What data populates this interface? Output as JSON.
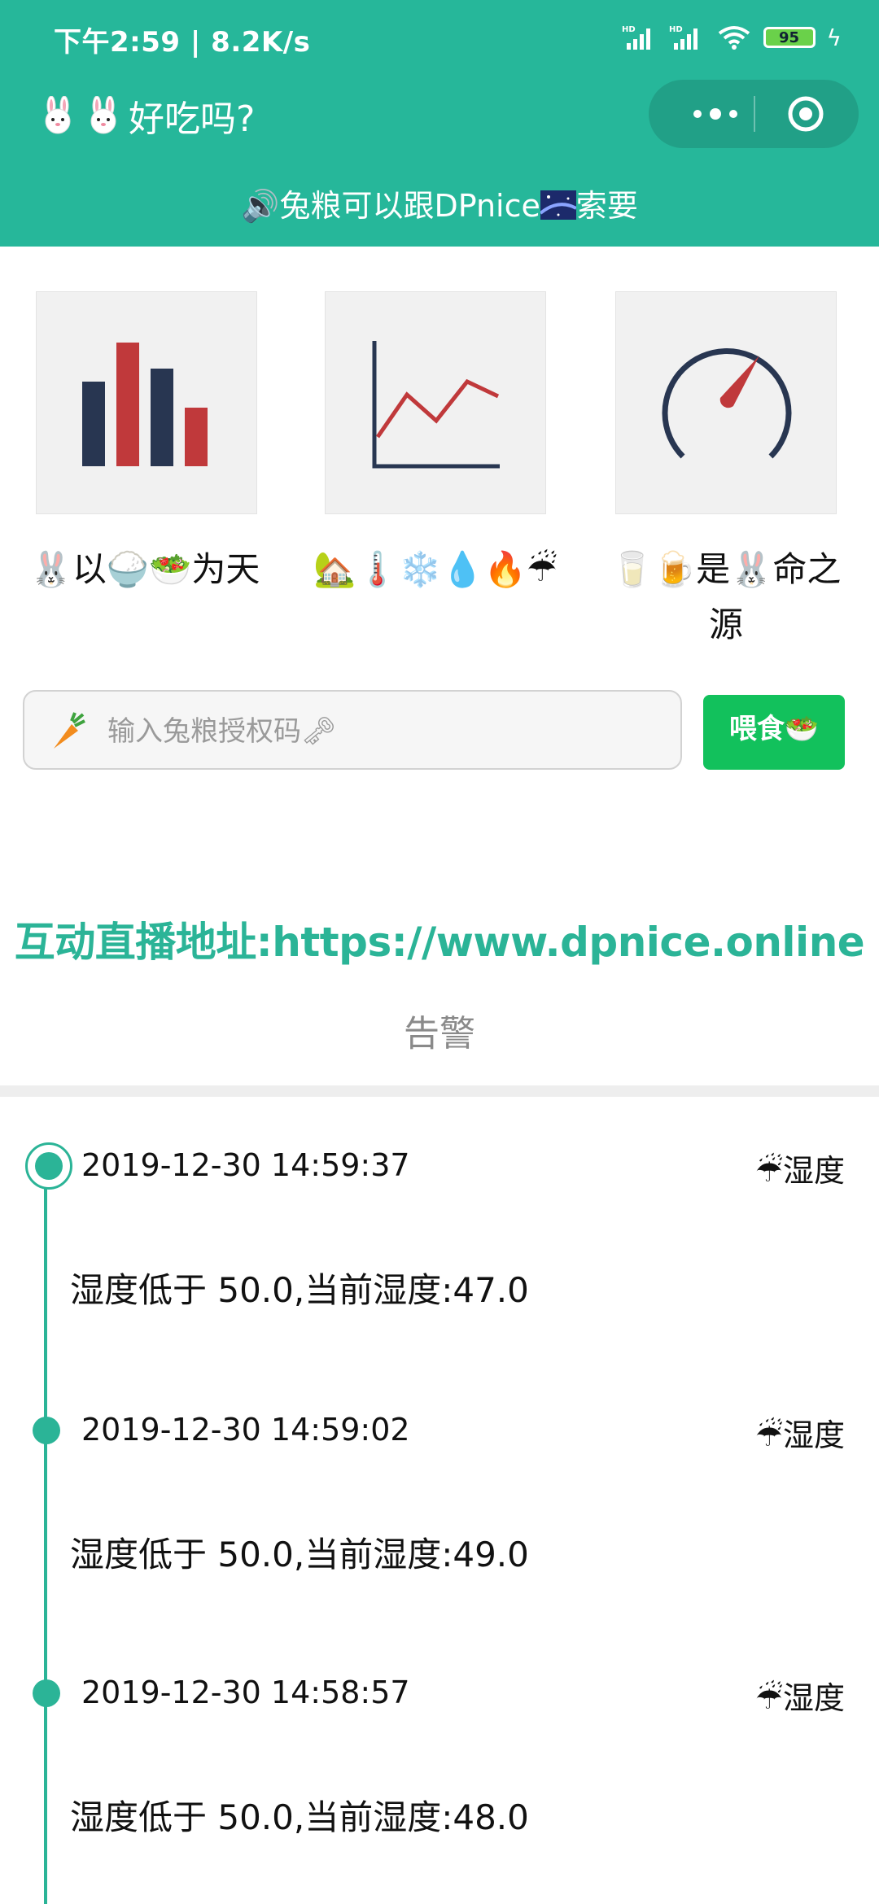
{
  "status_bar": {
    "time": "下午2:59 | 8.2K/s",
    "battery": "95"
  },
  "header": {
    "title": "好吃吗?",
    "announcement_prefix": "🔊",
    "announcement_text": "兔粮可以跟DPnice",
    "announcement_suffix": "索要"
  },
  "tiles": [
    {
      "label": "🐰以🍚🥗为天",
      "icon": "bar-chart-icon"
    },
    {
      "label": "🏡🌡️❄️💧🔥☔",
      "icon": "line-chart-icon"
    },
    {
      "label": "🥛🍺是🐰命之源",
      "icon": "gauge-icon"
    }
  ],
  "feed": {
    "placeholder": "输入兔粮授权码🗝",
    "button_label": "喂食🥗"
  },
  "live_link": "互动直播地址:https://www.dpnice.online",
  "alerts_title": "告警",
  "alerts": [
    {
      "time": "2019-12-30 14:59:37",
      "type": "☔湿度",
      "message": "湿度低于 50.0,当前湿度:47.0"
    },
    {
      "time": "2019-12-30 14:59:02",
      "type": "☔湿度",
      "message": "湿度低于 50.0,当前湿度:49.0"
    },
    {
      "time": "2019-12-30 14:58:57",
      "type": "☔湿度",
      "message": "湿度低于 50.0,当前湿度:48.0"
    }
  ],
  "colors": {
    "brand": "#26b79a",
    "feed_button": "#12c15c",
    "timeline": "#2bb497"
  }
}
